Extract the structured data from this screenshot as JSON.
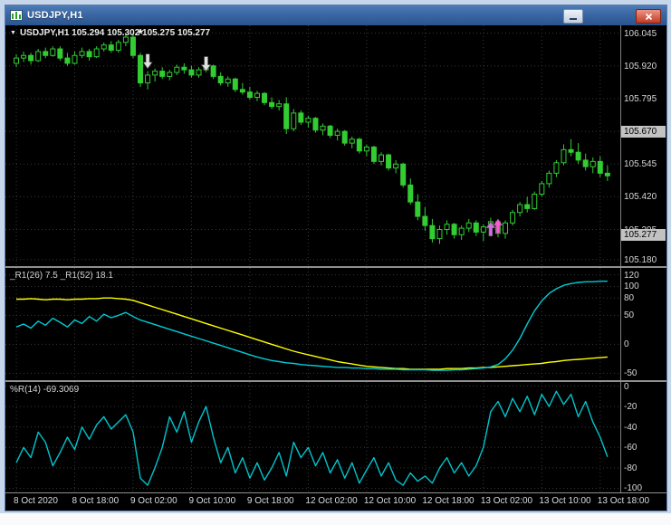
{
  "window": {
    "title": "USDJPY,H1"
  },
  "icons": {
    "symbol_dropdown": "▼",
    "star": "*"
  },
  "main_pane": {
    "info_label": "USDJPY,H1 105.294 105.302 105.275 105.277"
  },
  "time_axis": {
    "labels": [
      "8 Oct 2020",
      "8 Oct 18:00",
      "9 Oct 02:00",
      "9 Oct 10:00",
      "9 Oct 18:00",
      "12 Oct 02:00",
      "12 Oct 10:00",
      "12 Oct 18:00",
      "13 Oct 02:00",
      "13 Oct 10:00",
      "13 Oct 18:00"
    ],
    "bar_index": [
      0,
      8,
      16,
      24,
      32,
      40,
      48,
      56,
      64,
      72,
      80
    ]
  },
  "chart_data": [
    {
      "type": "candlestick",
      "pane": "main",
      "symbol": "USDJPY",
      "timeframe": "H1",
      "ohlc_readout": {
        "open": "105.294",
        "high": "105.302",
        "low": "105.275",
        "close": "105.277"
      },
      "y_range": [
        105.155,
        106.075
      ],
      "price_ticks": [
        "106.045",
        "105.920",
        "105.795",
        "105.670",
        "105.545",
        "105.420",
        "105.295",
        "105.180"
      ],
      "badges": [
        {
          "name": "level-badge",
          "value": "105.670"
        },
        {
          "name": "current-price-badge",
          "value": "105.277"
        }
      ],
      "colors": {
        "candle": "#33cc33",
        "bull_fill": "#000000",
        "grid": "#383838",
        "bg": "#000000",
        "axis_text": "#d6d6d6",
        "badge_bg": "#c2c2c2"
      },
      "markers": [
        {
          "kind": "star",
          "bar": 17,
          "price": 106.04,
          "color": "#ffffff"
        },
        {
          "kind": "arrow-down",
          "bar": 18,
          "price": 105.91,
          "color": "#e0e0e0"
        },
        {
          "kind": "arrow-down",
          "bar": 26,
          "price": 105.9,
          "color": "#e0e0e0"
        },
        {
          "kind": "arrow-up",
          "bar": 65,
          "price": 105.325,
          "color": "#cf6fe0"
        },
        {
          "kind": "arrow-up",
          "bar": 66,
          "price": 105.335,
          "color": "#ff5ad5"
        }
      ],
      "candles": [
        [
          105.93,
          105.965,
          105.915,
          105.95
        ],
        [
          105.95,
          105.975,
          105.935,
          105.96
        ],
        [
          105.96,
          105.97,
          105.925,
          105.94
        ],
        [
          105.94,
          105.985,
          105.935,
          105.975
        ],
        [
          105.975,
          105.99,
          105.95,
          105.96
        ],
        [
          105.96,
          105.995,
          105.955,
          105.985
        ],
        [
          105.985,
          105.995,
          105.94,
          105.95
        ],
        [
          105.95,
          105.97,
          105.92,
          105.93
        ],
        [
          105.93,
          105.975,
          105.925,
          105.96
        ],
        [
          105.96,
          105.99,
          105.95,
          105.975
        ],
        [
          105.975,
          105.985,
          105.94,
          105.955
        ],
        [
          105.955,
          105.995,
          105.95,
          105.985
        ],
        [
          105.985,
          106.01,
          105.975,
          106.0
        ],
        [
          106.0,
          106.015,
          105.97,
          105.98
        ],
        [
          105.98,
          106.02,
          105.97,
          106.01
        ],
        [
          106.01,
          106.045,
          105.995,
          106.03
        ],
        [
          106.03,
          106.04,
          105.95,
          105.96
        ],
        [
          105.96,
          105.97,
          105.84,
          105.855
        ],
        [
          105.855,
          105.9,
          105.83,
          105.885
        ],
        [
          105.885,
          105.91,
          105.86,
          105.9
        ],
        [
          105.9,
          105.915,
          105.87,
          105.88
        ],
        [
          105.88,
          105.905,
          105.865,
          105.895
        ],
        [
          105.895,
          105.925,
          105.885,
          105.915
        ],
        [
          105.915,
          105.93,
          105.89,
          105.905
        ],
        [
          105.905,
          105.92,
          105.875,
          105.885
        ],
        [
          105.885,
          105.915,
          105.875,
          105.905
        ],
        [
          105.905,
          105.93,
          105.895,
          105.92
        ],
        [
          105.92,
          105.925,
          105.87,
          105.88
        ],
        [
          105.88,
          105.895,
          105.845,
          105.855
        ],
        [
          105.855,
          105.88,
          105.84,
          105.87
        ],
        [
          105.87,
          105.875,
          105.82,
          105.83
        ],
        [
          105.83,
          105.855,
          105.81,
          105.82
        ],
        [
          105.82,
          105.84,
          105.79,
          105.8
        ],
        [
          105.8,
          105.825,
          105.785,
          105.815
        ],
        [
          105.815,
          105.82,
          105.77,
          105.78
        ],
        [
          105.78,
          105.8,
          105.755,
          105.765
        ],
        [
          105.765,
          105.79,
          105.75,
          105.775
        ],
        [
          105.775,
          105.8,
          105.66,
          105.68
        ],
        [
          105.68,
          105.755,
          105.67,
          105.74
        ],
        [
          105.74,
          105.75,
          105.695,
          105.705
        ],
        [
          105.705,
          105.73,
          105.685,
          105.72
        ],
        [
          105.72,
          105.725,
          105.665,
          105.675
        ],
        [
          105.675,
          105.7,
          105.655,
          105.69
        ],
        [
          105.69,
          105.695,
          105.645,
          105.655
        ],
        [
          105.655,
          105.68,
          105.635,
          105.67
        ],
        [
          105.67,
          105.675,
          105.615,
          105.625
        ],
        [
          105.625,
          105.65,
          105.605,
          105.64
        ],
        [
          105.64,
          105.645,
          105.585,
          105.595
        ],
        [
          105.595,
          105.62,
          105.575,
          105.61
        ],
        [
          105.61,
          105.615,
          105.545,
          105.555
        ],
        [
          105.555,
          105.59,
          105.54,
          105.58
        ],
        [
          105.58,
          105.585,
          105.52,
          105.53
        ],
        [
          105.53,
          105.56,
          105.51,
          105.545
        ],
        [
          105.545,
          105.55,
          105.455,
          105.465
        ],
        [
          105.465,
          105.49,
          105.39,
          105.4
        ],
        [
          105.4,
          105.43,
          105.33,
          105.345
        ],
        [
          105.345,
          105.38,
          105.29,
          105.31
        ],
        [
          105.31,
          105.335,
          105.245,
          105.26
        ],
        [
          105.26,
          105.31,
          105.24,
          105.295
        ],
        [
          105.295,
          105.33,
          105.275,
          105.315
        ],
        [
          105.315,
          105.32,
          105.26,
          105.275
        ],
        [
          105.275,
          105.31,
          105.255,
          105.3
        ],
        [
          105.3,
          105.335,
          105.285,
          105.32
        ],
        [
          105.32,
          105.33,
          105.27,
          105.285
        ],
        [
          105.285,
          105.315,
          105.25,
          105.305
        ],
        [
          105.305,
          105.34,
          105.29,
          105.325
        ],
        [
          105.325,
          105.335,
          105.265,
          105.28
        ],
        [
          105.28,
          105.33,
          105.26,
          105.32
        ],
        [
          105.32,
          105.37,
          105.31,
          105.36
        ],
        [
          105.36,
          105.4,
          105.345,
          105.39
        ],
        [
          105.39,
          105.42,
          105.36,
          105.375
        ],
        [
          105.375,
          105.44,
          105.37,
          105.43
        ],
        [
          105.43,
          105.48,
          105.42,
          105.47
        ],
        [
          105.47,
          105.52,
          105.455,
          105.51
        ],
        [
          105.51,
          105.56,
          105.495,
          105.55
        ],
        [
          105.55,
          105.62,
          105.54,
          105.6
        ],
        [
          105.6,
          105.64,
          105.575,
          105.59
        ],
        [
          105.59,
          105.625,
          105.545,
          105.56
        ],
        [
          105.56,
          105.585,
          105.52,
          105.535
        ],
        [
          105.535,
          105.57,
          105.51,
          105.555
        ],
        [
          105.555,
          105.575,
          105.495,
          105.51
        ],
        [
          105.51,
          105.54,
          105.48,
          105.5
        ]
      ]
    },
    {
      "type": "line",
      "pane": "indicator1",
      "label": "_R1(26) 7.5 _R1(52) 18.1",
      "y_range": [
        -62,
        132
      ],
      "ticks": [
        "120",
        "100",
        "80",
        "50",
        "0",
        "-50"
      ],
      "series": [
        {
          "name": "_R1(26)",
          "color": "#ffff00",
          "values": [
            78,
            78,
            79,
            78,
            77,
            78,
            78,
            77,
            78,
            78,
            79,
            79,
            80,
            80,
            79,
            78,
            76,
            72,
            68,
            64,
            60,
            56,
            52,
            48,
            44,
            40,
            36,
            32,
            28,
            24,
            20,
            16,
            12,
            8,
            4,
            0,
            -4,
            -8,
            -12,
            -15,
            -18,
            -21,
            -24,
            -27,
            -30,
            -32,
            -34,
            -36,
            -38,
            -39,
            -40,
            -41,
            -42,
            -42,
            -43,
            -43,
            -43,
            -43,
            -43,
            -42,
            -42,
            -42,
            -41,
            -41,
            -40,
            -40,
            -39,
            -38,
            -37,
            -36,
            -35,
            -34,
            -33,
            -31,
            -30,
            -28,
            -27,
            -26,
            -25,
            -24,
            -23,
            -22
          ]
        },
        {
          "name": "_R1(52)",
          "color": "#00ccd6",
          "values": [
            30,
            35,
            28,
            40,
            33,
            45,
            38,
            30,
            42,
            36,
            48,
            40,
            52,
            46,
            50,
            55,
            48,
            42,
            38,
            34,
            30,
            26,
            22,
            18,
            14,
            10,
            6,
            2,
            -2,
            -6,
            -10,
            -14,
            -18,
            -22,
            -25,
            -28,
            -30,
            -32,
            -33,
            -35,
            -36,
            -37,
            -38,
            -39,
            -40,
            -40,
            -41,
            -41,
            -42,
            -42,
            -43,
            -43,
            -43,
            -44,
            -44,
            -44,
            -44,
            -45,
            -45,
            -45,
            -44,
            -44,
            -43,
            -42,
            -41,
            -39,
            -35,
            -25,
            -10,
            10,
            35,
            58,
            75,
            88,
            96,
            102,
            105,
            107,
            108,
            108,
            109,
            109
          ]
        }
      ]
    },
    {
      "type": "line",
      "pane": "indicator2",
      "label": "%R(14) -69.3069",
      "y_range": [
        -104,
        4
      ],
      "ticks": [
        "0",
        "-20",
        "-40",
        "-60",
        "-80",
        "-100"
      ],
      "series": [
        {
          "name": "%R(14)",
          "color": "#00c4cc",
          "values": [
            -75,
            -60,
            -70,
            -45,
            -55,
            -78,
            -65,
            -50,
            -62,
            -40,
            -52,
            -38,
            -30,
            -42,
            -35,
            -28,
            -45,
            -90,
            -97,
            -80,
            -60,
            -30,
            -45,
            -25,
            -55,
            -35,
            -20,
            -50,
            -75,
            -60,
            -85,
            -70,
            -90,
            -75,
            -92,
            -80,
            -65,
            -88,
            -55,
            -70,
            -60,
            -78,
            -65,
            -85,
            -72,
            -90,
            -75,
            -95,
            -82,
            -70,
            -88,
            -75,
            -92,
            -97,
            -85,
            -93,
            -88,
            -95,
            -80,
            -70,
            -85,
            -75,
            -88,
            -78,
            -60,
            -25,
            -15,
            -30,
            -12,
            -25,
            -10,
            -28,
            -8,
            -20,
            -5,
            -18,
            -8,
            -30,
            -15,
            -35,
            -50,
            -69.3
          ]
        }
      ]
    }
  ]
}
